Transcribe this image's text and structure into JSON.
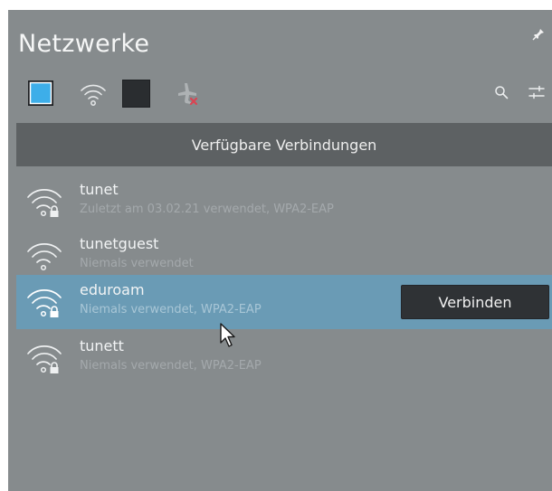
{
  "app": {
    "title": "Netzwerke"
  },
  "toolbar": {
    "icons": [
      "wired-network-icon",
      "wifi-icon",
      "mobile-broadband-icon",
      "airplane-mode-icon",
      "search-icon",
      "configure-icon"
    ]
  },
  "section": {
    "header": "Verfügbare Verbindungen"
  },
  "networks": [
    {
      "name": "tunet",
      "detail": "Zuletzt am 03.02.21 verwendet, WPA2-EAP",
      "secured": true,
      "selected": false
    },
    {
      "name": "tunetguest",
      "detail": "Niemals verwendet",
      "secured": false,
      "selected": false
    },
    {
      "name": "eduroam",
      "detail": "Niemals verwendet, WPA2-EAP",
      "secured": true,
      "selected": true,
      "action": "Verbinden"
    },
    {
      "name": "tunett",
      "detail": "Niemals verwendet, WPA2-EAP",
      "secured": true,
      "selected": false
    }
  ],
  "colors": {
    "panel_bg": "#868b8d",
    "header_bg": "#5d6163",
    "selected_bg": "#6a9bb5",
    "accent": "#3daee9",
    "button_bg": "#2f3235",
    "disabled_x": "#da4453"
  }
}
